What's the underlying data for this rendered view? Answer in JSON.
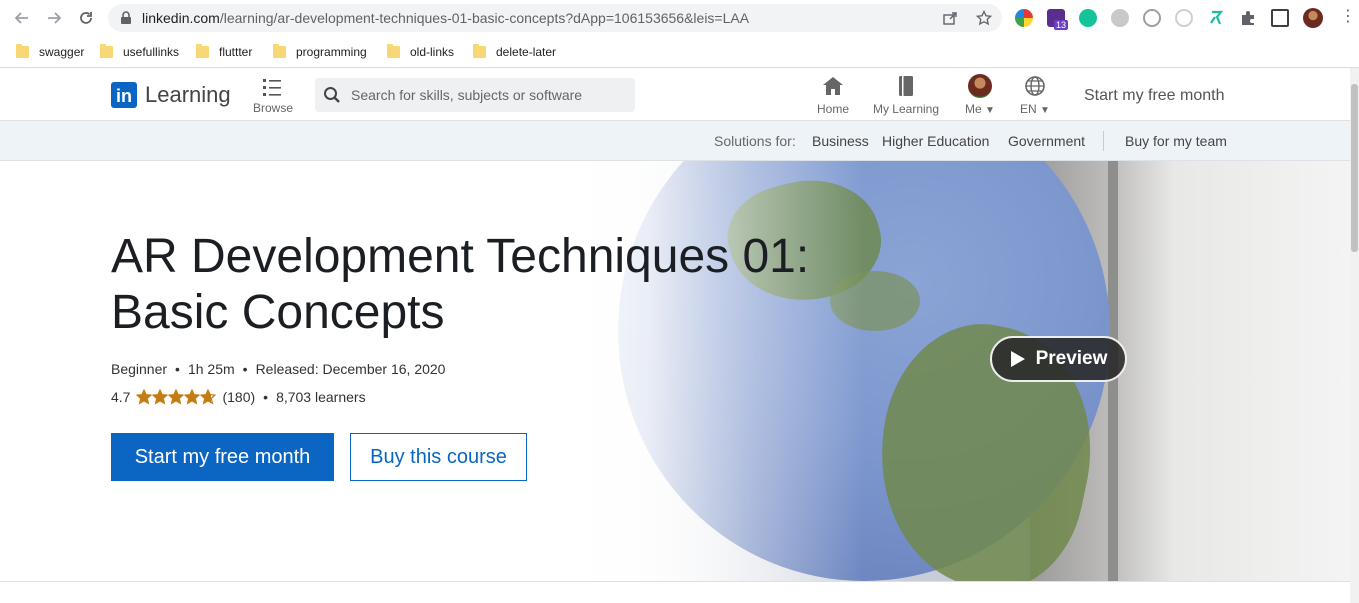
{
  "browser": {
    "url_host": "linkedin.com",
    "url_path": "/learning/ar-development-techniques-01-basic-concepts?dApp=106153656&leis=LAA",
    "bookmarks": [
      "swagger",
      "usefullinks",
      "fluttter",
      "programming",
      "old-links",
      "delete-later"
    ],
    "extension_badge": "13"
  },
  "header": {
    "logo_in": "in",
    "logo_word": "Learning",
    "browse_label": "Browse",
    "search_placeholder": "Search for skills, subjects or software",
    "nav": {
      "home": "Home",
      "my_learning": "My Learning",
      "me": "Me",
      "language": "EN"
    },
    "start_free_month": "Start my free month"
  },
  "subnav": {
    "solutions_label": "Solutions for:",
    "links": [
      "Business",
      "Higher Education",
      "Government"
    ],
    "buy_for_team": "Buy for my team"
  },
  "course": {
    "title": "AR Development Techniques 01: Basic Concepts",
    "level": "Beginner",
    "duration": "1h 25m",
    "released": "Released: December 16, 2020",
    "rating": "4.7",
    "rating_value": 4.7,
    "review_count": "(180)",
    "learners": "8,703 learners",
    "primary_cta": "Start my free month",
    "secondary_cta": "Buy this course",
    "preview_label": "Preview"
  },
  "colors": {
    "brand_blue": "#0a66c2",
    "star_color": "#c37d16"
  }
}
